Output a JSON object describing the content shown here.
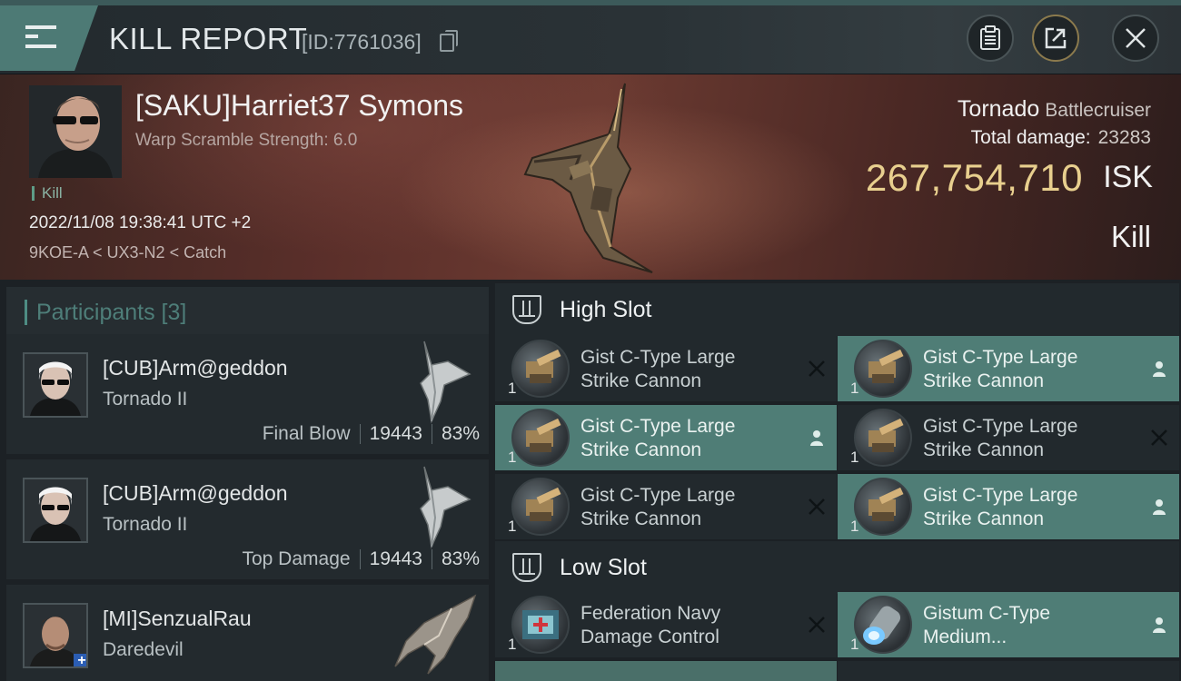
{
  "header": {
    "title": "KILL REPORT",
    "report_id": "[ID:7761036]"
  },
  "victim": {
    "name": "[SAKU]Harriet37 Symons",
    "scramble": "Warp Scramble Strength: 6.0",
    "tag": "Kill",
    "datetime": "2022/11/08 19:38:41 UTC +2",
    "location": "9KOE-A < UX3-N2 < Catch",
    "ship_name": "Tornado",
    "ship_class": "Battlecruiser",
    "total_damage_label": "Total damage:",
    "total_damage": "23283",
    "isk_value": "267,754,710",
    "isk_unit": "ISK",
    "result": "Kill"
  },
  "participants": {
    "label": "Participants [3]",
    "items": [
      {
        "name": "[CUB]Arm@geddon",
        "ship": "Tornado II",
        "role": "Final Blow",
        "damage": "19443",
        "percent": "83%"
      },
      {
        "name": "[CUB]Arm@geddon",
        "ship": "Tornado II",
        "role": "Top Damage",
        "damage": "19443",
        "percent": "83%"
      },
      {
        "name": "[MI]SenzualRau",
        "ship": "Daredevil"
      }
    ]
  },
  "slots": {
    "high": {
      "title": "High Slot",
      "modules": [
        {
          "line1": "Gist C-Type Large",
          "line2": "Strike Cannon",
          "qty": "1",
          "status": "destroyed-x-icon"
        },
        {
          "line1": "Gist C-Type Large",
          "line2": "Strike Cannon",
          "qty": "1",
          "status": "dropped-person-icon"
        },
        {
          "line1": "Gist C-Type Large",
          "line2": "Strike Cannon",
          "qty": "1",
          "status": "dropped-person-icon"
        },
        {
          "line1": "Gist C-Type Large",
          "line2": "Strike Cannon",
          "qty": "1",
          "status": "destroyed-x-icon"
        },
        {
          "line1": "Gist C-Type Large",
          "line2": "Strike Cannon",
          "qty": "1",
          "status": "destroyed-x-icon"
        },
        {
          "line1": "Gist C-Type Large",
          "line2": "Strike Cannon",
          "qty": "1",
          "status": "dropped-person-icon"
        }
      ]
    },
    "low": {
      "title": "Low Slot",
      "modules": [
        {
          "line1": "Federation Navy",
          "line2": "Damage Control",
          "qty": "1",
          "status": "destroyed-x-icon"
        },
        {
          "line1": "Gistum C-Type",
          "line2": "Medium...",
          "qty": "1",
          "status": "dropped-person-icon"
        }
      ]
    }
  },
  "colors": {
    "accent_teal": "#4f7d76",
    "isk_gold": "#e8cf8e",
    "panel": "#22292d"
  }
}
